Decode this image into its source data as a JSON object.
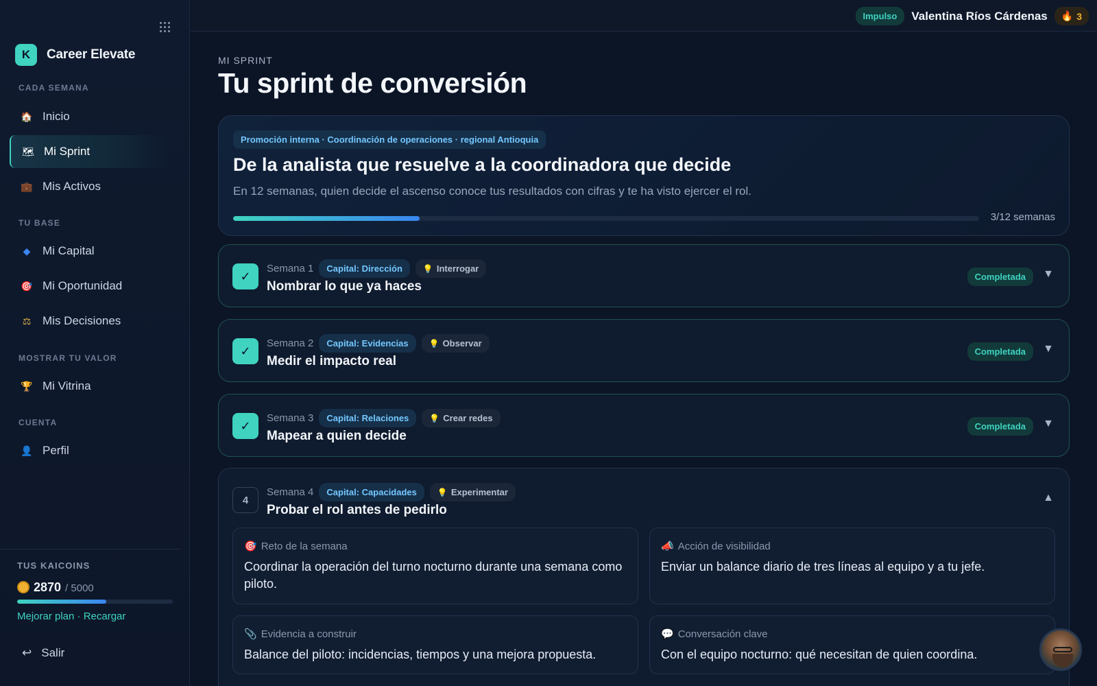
{
  "sidebar": {
    "brand": {
      "logo_letter": "K",
      "name": "Career Elevate"
    },
    "sections": {
      "cada_semana": "CADA SEMANA",
      "tu_base": "TU BASE",
      "mostrar_valor": "MOSTRAR TU VALOR",
      "cuenta": "CUENTA"
    },
    "items": [
      {
        "label": "Inicio",
        "icon": "house-icon",
        "glyph": "🏠"
      },
      {
        "label": "Mi Sprint",
        "icon": "map-icon",
        "glyph": "🗺"
      },
      {
        "label": "Mis Activos",
        "icon": "briefcase-icon",
        "glyph": "💼"
      },
      {
        "label": "Mi Capital",
        "icon": "diamond-icon",
        "glyph": "◆"
      },
      {
        "label": "Mi Oportunidad",
        "icon": "target-icon",
        "glyph": "🎯"
      },
      {
        "label": "Mis Decisiones",
        "icon": "scales-icon",
        "glyph": "⚖"
      },
      {
        "label": "Mi Vitrina",
        "icon": "trophy-icon",
        "glyph": "🏆"
      },
      {
        "label": "Perfil",
        "icon": "user-icon",
        "glyph": "👤"
      }
    ],
    "kaicoins": {
      "label": "TUS KAICOINS",
      "value": "2870",
      "max": "/ 5000",
      "progress": 0.574,
      "links": "Mejorar plan · Recargar"
    },
    "logout": {
      "label": "Salir",
      "glyph": "↩"
    }
  },
  "topbar": {
    "plan_badge": "Impulso",
    "user_name": "Valentina Ríos Cárdenas",
    "streak_glyph": "🔥",
    "streak": "3"
  },
  "main": {
    "eyebrow": "MI SPRINT",
    "title": "Tu sprint de conversión",
    "hero": {
      "tag": "Promoción interna · Coordinación de operaciones · regional Antioquia",
      "title": "De la analista que resuelve a la coordinadora que decide",
      "subtitle": "En 12 semanas, quien decide el ascenso conoce tus resultados con cifras y te ha visto ejercer el rol.",
      "progress": 0.25,
      "weeks": "3/12 semanas"
    },
    "weeks": [
      {
        "label": "Semana 1",
        "capital": "Capital: Dirección",
        "skill": "Interrogar",
        "title": "Nombrar lo que ya haces",
        "status": "Completada",
        "check": "✓",
        "chevron": "▼"
      },
      {
        "label": "Semana 2",
        "capital": "Capital: Evidencias",
        "skill": "Observar",
        "title": "Medir el impacto real",
        "status": "Completada",
        "check": "✓",
        "chevron": "▼"
      },
      {
        "label": "Semana 3",
        "capital": "Capital: Relaciones",
        "skill": "Crear redes",
        "title": "Mapear a quien decide",
        "status": "Completada",
        "check": "✓",
        "chevron": "▼"
      },
      {
        "number": "4",
        "label": "Semana 4",
        "capital": "Capital: Capacidades",
        "skill": "Experimentar",
        "title": "Probar el rol antes de pedirlo",
        "chevron": "▲",
        "cards": [
          {
            "glyph": "🎯",
            "label": "Reto de la semana",
            "text": "Coordinar la operación del turno nocturno durante una semana como piloto."
          },
          {
            "glyph": "📣",
            "label": "Acción de visibilidad",
            "text": "Enviar un balance diario de tres líneas al equipo y a tu jefe."
          },
          {
            "glyph": "📎",
            "label": "Evidencia a construir",
            "text": "Balance del piloto: incidencias, tiempos y una mejora propuesta."
          },
          {
            "glyph": "💬",
            "label": "Conversación clave",
            "text": "Con el equipo nocturno: qué necesitan de quien coordina."
          }
        ]
      }
    ],
    "bulb": "💡"
  },
  "colors": {
    "accent": "#3fd3c0",
    "accent_blue": "#3a86f0",
    "background": "#0c1526",
    "tag_blue": "#74c7ff"
  }
}
